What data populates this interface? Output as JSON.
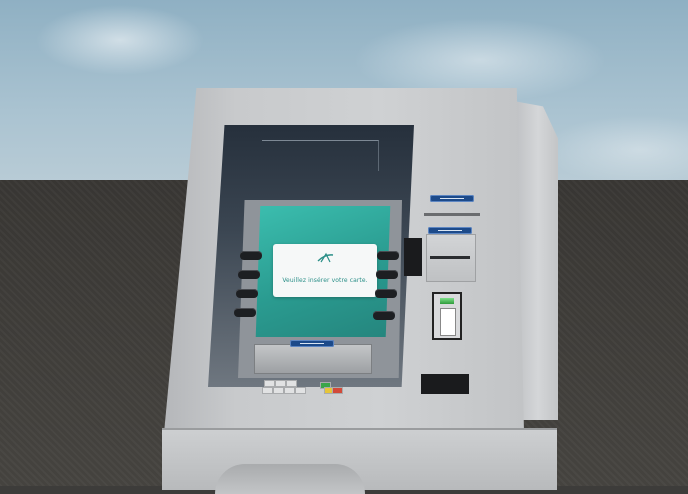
{
  "scene": {
    "description_colors": {
      "screen": "#2fa79b",
      "dialog_text": "#2b8f88",
      "slot_label": "#1c4a8a"
    }
  },
  "atm": {
    "screen": {
      "prompt": "Veuillez insérer votre carte.",
      "logo_icon": "ca-logo-icon"
    },
    "left_fdk_count": 4,
    "right_fdk_count": 4
  }
}
